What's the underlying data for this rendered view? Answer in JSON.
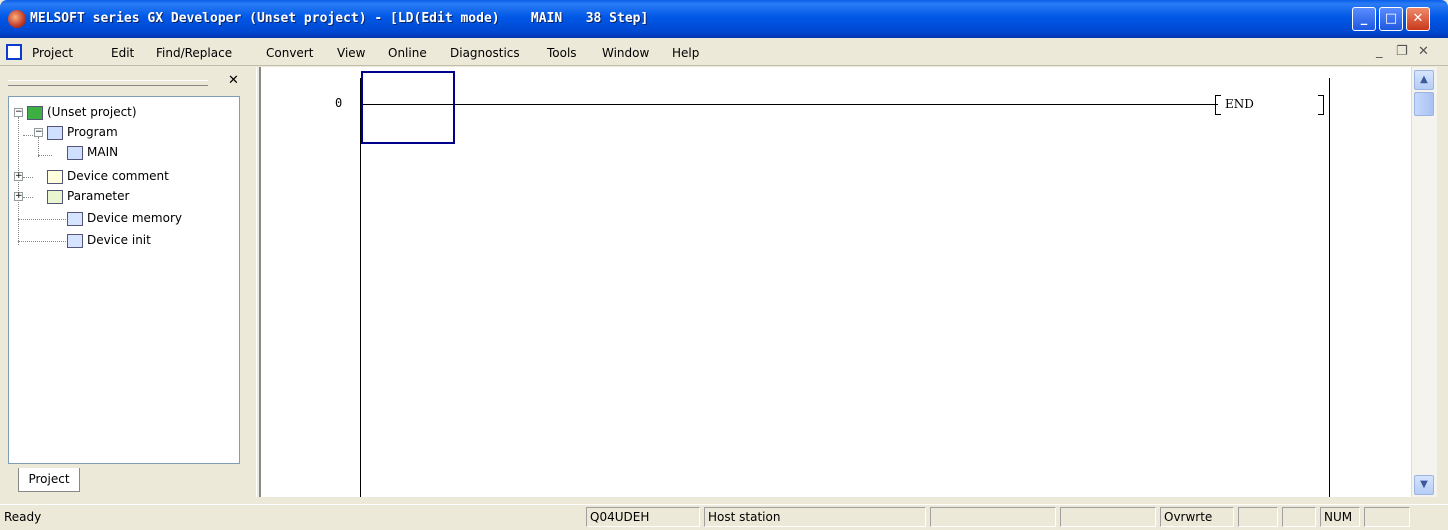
{
  "window": {
    "title": "MELSOFT series GX Developer (Unset project) - [LD(Edit mode)    MAIN   38 Step]",
    "min_glyph": "_",
    "max_glyph": "□",
    "close_glyph": "✕"
  },
  "menubar": {
    "items": [
      "Project",
      "Edit",
      "Find/Replace",
      "Convert",
      "View",
      "Online",
      "Diagnostics",
      "Tools",
      "Window",
      "Help"
    ],
    "mdi_min": "_",
    "mdi_restore": "❐",
    "mdi_close": "✕"
  },
  "project_pane": {
    "close_glyph": "✕",
    "tab": "Project",
    "tree": [
      {
        "label": "(Unset project)",
        "icon": "project-icon"
      },
      {
        "label": "Program",
        "icon": "program-icon"
      },
      {
        "label": "MAIN",
        "icon": "program-icon"
      },
      {
        "label": "Device comment",
        "icon": "comment-icon"
      },
      {
        "label": "Parameter",
        "icon": "parameter-icon"
      },
      {
        "label": "Device memory",
        "icon": "memory-icon"
      },
      {
        "label": "Device init",
        "icon": "memory-icon"
      }
    ],
    "expand_minus": "−",
    "expand_plus": "+"
  },
  "ladder": {
    "step": "0",
    "end_instruction": "END"
  },
  "scrollbar": {
    "up": "▲",
    "down": "▼"
  },
  "statusbar": {
    "status": "Ready",
    "plc_type": "Q04UDEH",
    "station": "Host station",
    "mode": "Ovrwrte",
    "num": "NUM"
  }
}
